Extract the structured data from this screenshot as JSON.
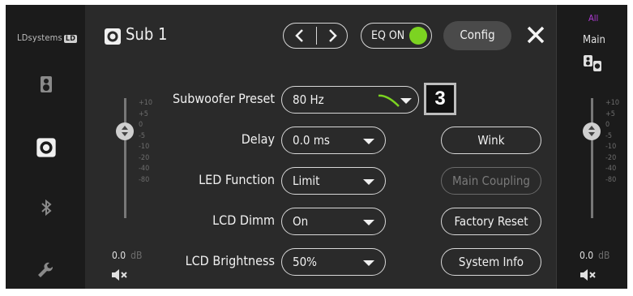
{
  "brand": {
    "text": "LDsystems",
    "badge": "LD"
  },
  "header": {
    "title": "Sub 1",
    "eq_label": "EQ ON",
    "config_label": "Config",
    "eq_on": true,
    "eq_color": "#7cd321"
  },
  "sidebar": {
    "items": [
      {
        "icon": "speaker-pair-icon"
      },
      {
        "icon": "subwoofer-icon",
        "active": true
      },
      {
        "icon": "bluetooth-icon"
      },
      {
        "icon": "wrench-icon"
      }
    ]
  },
  "settings": {
    "rows": [
      {
        "label": "Subwoofer Preset",
        "value": "80 Hz"
      },
      {
        "label": "Delay",
        "value": "0.0 ms"
      },
      {
        "label": "LED Function",
        "value": "Limit"
      },
      {
        "label": "LCD Dimm",
        "value": "On"
      },
      {
        "label": "LCD Brightness",
        "value": "50%"
      }
    ],
    "buttons": [
      {
        "label": "Wink",
        "enabled": true
      },
      {
        "label": "Main Coupling",
        "enabled": false
      },
      {
        "label": "Factory Reset",
        "enabled": true
      },
      {
        "label": "System Info",
        "enabled": true
      }
    ],
    "badge": "3"
  },
  "left_fader": {
    "ticks": [
      "+10",
      "+5",
      "0",
      "-5",
      "-10",
      "-20",
      "-40",
      "-80"
    ],
    "value": "0.0",
    "unit": "dB"
  },
  "right_panel": {
    "all_label": "All",
    "all_color": "#b13bd6",
    "main_label": "Main"
  },
  "right_fader": {
    "ticks": [
      "+10",
      "+5",
      "0",
      "-5",
      "-10",
      "-20",
      "-40",
      "-80"
    ],
    "value": "0.0",
    "unit": "dB"
  }
}
